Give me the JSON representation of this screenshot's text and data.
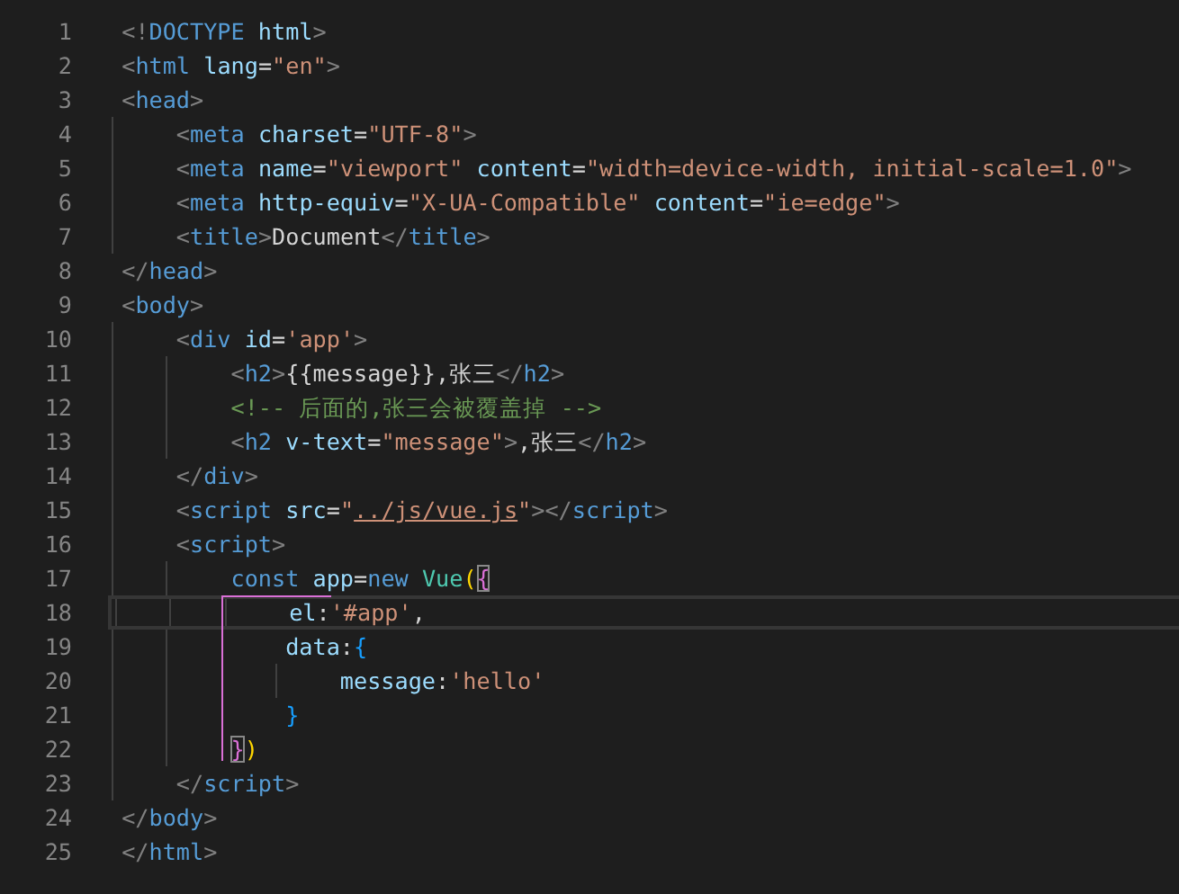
{
  "editor": {
    "lines": [
      {
        "number": "1",
        "current": false,
        "tokens": [
          {
            "kind": "punct",
            "text": "<!"
          },
          {
            "kind": "tag",
            "text": "DOCTYPE"
          },
          {
            "kind": "attr",
            "text": " html"
          },
          {
            "kind": "punct",
            "text": ">"
          }
        ]
      },
      {
        "number": "2",
        "current": false,
        "tokens": [
          {
            "kind": "punct",
            "text": "<"
          },
          {
            "kind": "tag",
            "text": "html"
          },
          {
            "kind": "attr",
            "text": " lang"
          },
          {
            "kind": "text",
            "text": "="
          },
          {
            "kind": "string",
            "text": "\"en\""
          },
          {
            "kind": "punct",
            "text": ">"
          }
        ]
      },
      {
        "number": "3",
        "current": false,
        "tokens": [
          {
            "kind": "punct",
            "text": "<"
          },
          {
            "kind": "tag",
            "text": "head"
          },
          {
            "kind": "punct",
            "text": ">"
          }
        ],
        "children": [
          {
            "number": "4",
            "current": false,
            "tokens": [
              {
                "kind": "punct",
                "text": "<"
              },
              {
                "kind": "tag",
                "text": "meta"
              },
              {
                "kind": "attr",
                "text": " charset"
              },
              {
                "kind": "text",
                "text": "="
              },
              {
                "kind": "string",
                "text": "\"UTF-8\""
              },
              {
                "kind": "punct",
                "text": ">"
              }
            ]
          },
          {
            "number": "5",
            "current": false,
            "tokens": [
              {
                "kind": "punct",
                "text": "<"
              },
              {
                "kind": "tag",
                "text": "meta"
              },
              {
                "kind": "attr",
                "text": " name"
              },
              {
                "kind": "text",
                "text": "="
              },
              {
                "kind": "string",
                "text": "\"viewport\""
              },
              {
                "kind": "attr",
                "text": " content"
              },
              {
                "kind": "text",
                "text": "="
              },
              {
                "kind": "string",
                "text": "\"width=device-width, initial-scale=1.0\""
              },
              {
                "kind": "punct",
                "text": ">"
              }
            ]
          },
          {
            "number": "6",
            "current": false,
            "tokens": [
              {
                "kind": "punct",
                "text": "<"
              },
              {
                "kind": "tag",
                "text": "meta"
              },
              {
                "kind": "attr",
                "text": " http-equiv"
              },
              {
                "kind": "text",
                "text": "="
              },
              {
                "kind": "string",
                "text": "\"X-UA-Compatible\""
              },
              {
                "kind": "attr",
                "text": " content"
              },
              {
                "kind": "text",
                "text": "="
              },
              {
                "kind": "string",
                "text": "\"ie=edge\""
              },
              {
                "kind": "punct",
                "text": ">"
              }
            ]
          },
          {
            "number": "7",
            "current": false,
            "tokens": [
              {
                "kind": "punct",
                "text": "<"
              },
              {
                "kind": "tag",
                "text": "title"
              },
              {
                "kind": "punct",
                "text": ">"
              },
              {
                "kind": "text",
                "text": "Document"
              },
              {
                "kind": "punct",
                "text": "</"
              },
              {
                "kind": "tag",
                "text": "title"
              },
              {
                "kind": "punct",
                "text": ">"
              }
            ]
          }
        ]
      },
      {
        "number": "8",
        "current": false,
        "tokens": [
          {
            "kind": "punct",
            "text": "</"
          },
          {
            "kind": "tag",
            "text": "head"
          },
          {
            "kind": "punct",
            "text": ">"
          }
        ]
      },
      {
        "number": "9",
        "current": false,
        "tokens": [
          {
            "kind": "punct",
            "text": "<"
          },
          {
            "kind": "tag",
            "text": "body"
          },
          {
            "kind": "punct",
            "text": ">"
          }
        ],
        "children": [
          {
            "number": "10",
            "current": false,
            "tokens": [
              {
                "kind": "punct",
                "text": "<"
              },
              {
                "kind": "tag",
                "text": "div"
              },
              {
                "kind": "attr",
                "text": " id"
              },
              {
                "kind": "text",
                "text": "="
              },
              {
                "kind": "string",
                "text": "'app'"
              },
              {
                "kind": "punct",
                "text": ">"
              }
            ],
            "children": [
              {
                "number": "11",
                "current": false,
                "tokens": [
                  {
                    "kind": "punct",
                    "text": "<"
                  },
                  {
                    "kind": "tag",
                    "text": "h2"
                  },
                  {
                    "kind": "punct",
                    "text": ">"
                  },
                  {
                    "kind": "text",
                    "text": "{{message}},张三"
                  },
                  {
                    "kind": "punct",
                    "text": "</"
                  },
                  {
                    "kind": "tag",
                    "text": "h2"
                  },
                  {
                    "kind": "punct",
                    "text": ">"
                  }
                ]
              },
              {
                "number": "12",
                "current": false,
                "tokens": [
                  {
                    "kind": "comment",
                    "text": "<!-- 后面的,张三会被覆盖掉 -->"
                  }
                ]
              },
              {
                "number": "13",
                "current": false,
                "tokens": [
                  {
                    "kind": "punct",
                    "text": "<"
                  },
                  {
                    "kind": "tag",
                    "text": "h2"
                  },
                  {
                    "kind": "attr",
                    "text": " v-text"
                  },
                  {
                    "kind": "text",
                    "text": "="
                  },
                  {
                    "kind": "string",
                    "text": "\"message\""
                  },
                  {
                    "kind": "punct",
                    "text": ">"
                  },
                  {
                    "kind": "text",
                    "text": ",张三"
                  },
                  {
                    "kind": "punct",
                    "text": "</"
                  },
                  {
                    "kind": "tag",
                    "text": "h2"
                  },
                  {
                    "kind": "punct",
                    "text": ">"
                  }
                ]
              }
            ]
          },
          {
            "number": "14",
            "current": false,
            "tokens": [
              {
                "kind": "punct",
                "text": "</"
              },
              {
                "kind": "tag",
                "text": "div"
              },
              {
                "kind": "punct",
                "text": ">"
              }
            ]
          },
          {
            "number": "15",
            "current": false,
            "tokens": [
              {
                "kind": "punct",
                "text": "<"
              },
              {
                "kind": "tag",
                "text": "script"
              },
              {
                "kind": "attr",
                "text": " src"
              },
              {
                "kind": "text",
                "text": "="
              },
              {
                "kind": "string",
                "text": "\""
              },
              {
                "kind": "link",
                "text": "../js/vue.js"
              },
              {
                "kind": "string",
                "text": "\""
              },
              {
                "kind": "punct",
                "text": "></"
              },
              {
                "kind": "tag",
                "text": "script"
              },
              {
                "kind": "punct",
                "text": ">"
              }
            ]
          },
          {
            "number": "16",
            "current": false,
            "tokens": [
              {
                "kind": "punct",
                "text": "<"
              },
              {
                "kind": "tag",
                "text": "script"
              },
              {
                "kind": "punct",
                "text": ">"
              }
            ],
            "children": [
              {
                "number": "17",
                "current": false,
                "tokens": [
                  {
                    "kind": "keyword",
                    "text": "const"
                  },
                  {
                    "kind": "attr",
                    "text": " app"
                  },
                  {
                    "kind": "text",
                    "text": "="
                  },
                  {
                    "kind": "keyword",
                    "text": "new"
                  },
                  {
                    "kind": "class",
                    "text": " Vue"
                  },
                  {
                    "kind": "bracket1",
                    "text": "(",
                    "matched": false
                  },
                  {
                    "kind": "bracket2",
                    "text": "{",
                    "matched": true
                  }
                ],
                "children": [
                  {
                    "number": "18",
                    "current": true,
                    "tokens": [
                      {
                        "kind": "attr",
                        "text": "el"
                      },
                      {
                        "kind": "text",
                        "text": ":"
                      },
                      {
                        "kind": "string",
                        "text": "'#app'"
                      },
                      {
                        "kind": "text",
                        "text": ","
                      }
                    ]
                  },
                  {
                    "number": "19",
                    "current": false,
                    "tokens": [
                      {
                        "kind": "attr",
                        "text": "data"
                      },
                      {
                        "kind": "text",
                        "text": ":"
                      },
                      {
                        "kind": "bracket3",
                        "text": "{",
                        "matched": false
                      }
                    ],
                    "children": [
                      {
                        "number": "20",
                        "current": false,
                        "tokens": [
                          {
                            "kind": "attr",
                            "text": "message"
                          },
                          {
                            "kind": "text",
                            "text": ":"
                          },
                          {
                            "kind": "string",
                            "text": "'hello'"
                          }
                        ]
                      }
                    ]
                  },
                  {
                    "number": "21",
                    "current": false,
                    "tokens": [
                      {
                        "kind": "bracket3",
                        "text": "}",
                        "matched": false
                      }
                    ]
                  }
                ]
              },
              {
                "number": "22",
                "current": false,
                "tokens": [
                  {
                    "kind": "bracket2",
                    "text": "}",
                    "matched": true
                  },
                  {
                    "kind": "bracket1",
                    "text": ")",
                    "matched": false
                  }
                ]
              }
            ]
          },
          {
            "number": "23",
            "current": false,
            "tokens": [
              {
                "kind": "punct",
                "text": "</"
              },
              {
                "kind": "tag",
                "text": "script"
              },
              {
                "kind": "punct",
                "text": ">"
              }
            ]
          }
        ]
      },
      {
        "number": "24",
        "current": false,
        "tokens": [
          {
            "kind": "punct",
            "text": "</"
          },
          {
            "kind": "tag",
            "text": "body"
          },
          {
            "kind": "punct",
            "text": ">"
          }
        ]
      },
      {
        "number": "25",
        "current": false,
        "tokens": [
          {
            "kind": "punct",
            "text": "</"
          },
          {
            "kind": "tag",
            "text": "html"
          },
          {
            "kind": "punct",
            "text": ">"
          }
        ]
      }
    ]
  }
}
